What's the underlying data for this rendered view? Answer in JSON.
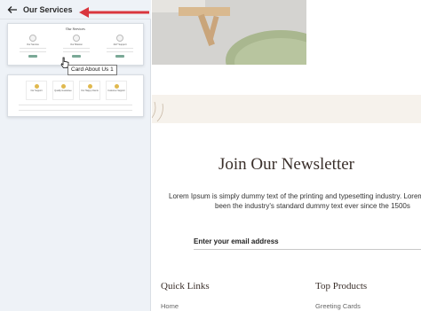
{
  "sidebar": {
    "title": "Our Services",
    "thumbnails": [
      {
        "title": "Our Services",
        "items": [
          "Our Service",
          "Our Mission",
          "24/7 Support"
        ]
      },
      {
        "items": [
          "Our Support",
          "Quality Guarantee",
          "Our Happy Clients",
          "Customer Support"
        ]
      }
    ],
    "tooltip": "Card About Us 1"
  },
  "main": {
    "newsletter": {
      "title": "Join Our Newsletter",
      "text_line1": "Lorem Ipsum is simply dummy text of the printing and typesetting industry. Lorem",
      "text_line2": "been the industry's standard dummy text ever since the 1500s",
      "email_placeholder": "Enter your email address"
    },
    "footer": {
      "quick_links_title": "Quick Links",
      "quick_links": [
        "Home"
      ],
      "top_products_title": "Top Products",
      "top_products": [
        "Greeting Cards"
      ]
    }
  },
  "colors": {
    "annotation_arrow": "#d9363e",
    "accent_green": "#7aa896",
    "sidebar_bg": "#eef2f7"
  }
}
